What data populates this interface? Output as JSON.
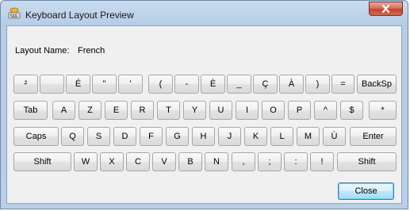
{
  "window": {
    "title": "Keyboard Layout Preview"
  },
  "layout": {
    "label": "Layout Name:",
    "value": "French"
  },
  "keyboard": {
    "row1": [
      "²",
      "",
      "É",
      "\"",
      "'",
      "(",
      "-",
      "È",
      "_",
      "Ç",
      "À",
      ")",
      "=",
      "BackSp"
    ],
    "row2": [
      "Tab",
      "A",
      "Z",
      "E",
      "R",
      "T",
      "Y",
      "U",
      "I",
      "O",
      "P",
      "^",
      "$",
      "*"
    ],
    "row3": [
      "Caps",
      "Q",
      "S",
      "D",
      "F",
      "G",
      "H",
      "J",
      "K",
      "L",
      "M",
      "Ù",
      "Enter"
    ],
    "row4": [
      "Shift",
      "W",
      "X",
      "C",
      "V",
      "B",
      "N",
      ",",
      ";",
      ":",
      "!",
      "Shift"
    ]
  },
  "buttons": {
    "close": "Close"
  }
}
